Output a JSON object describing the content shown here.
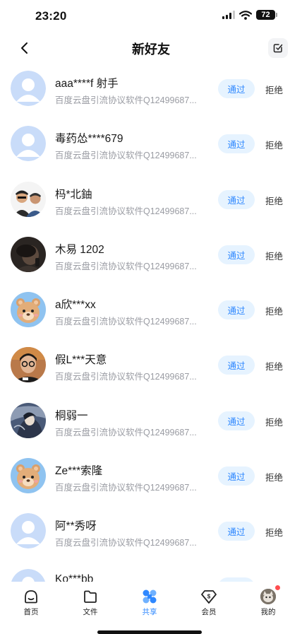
{
  "status_bar": {
    "time": "23:20",
    "battery": "72"
  },
  "nav": {
    "title": "新好友"
  },
  "request_subtitle": "百度云盘引流协议软件Q12499687...",
  "buttons": {
    "approve": "通过",
    "reject": "拒绝"
  },
  "requests": [
    {
      "name": "aaa****f 射手",
      "avatar": "default"
    },
    {
      "name": "毒药怂****679",
      "avatar": "default"
    },
    {
      "name": "杩*北鈾",
      "avatar": "photo-two-people"
    },
    {
      "name": "木易 1202",
      "avatar": "photo-dark"
    },
    {
      "name": "a欣***xx",
      "avatar": "bear"
    },
    {
      "name": "假L***天意",
      "avatar": "photo-glasses-boy"
    },
    {
      "name": "桐弱一",
      "avatar": "photo-artwork"
    },
    {
      "name": "Ze***索隆",
      "avatar": "bear"
    },
    {
      "name": "阿**秀呀",
      "avatar": "default"
    },
    {
      "name": "Ko***bb",
      "avatar": "default"
    }
  ],
  "tabbar": {
    "items": [
      {
        "label": "首页",
        "icon": "home-icon"
      },
      {
        "label": "文件",
        "icon": "folder-icon"
      },
      {
        "label": "共享",
        "icon": "share-icon",
        "active": true
      },
      {
        "label": "会员",
        "icon": "vip-icon"
      },
      {
        "label": "我的",
        "icon": "profile-avatar"
      }
    ]
  },
  "colors": {
    "accent": "#2f88ff",
    "approve_bg": "#e6f3ff",
    "subtitle": "#9a9ca3",
    "badge": "#ff4d4f"
  }
}
